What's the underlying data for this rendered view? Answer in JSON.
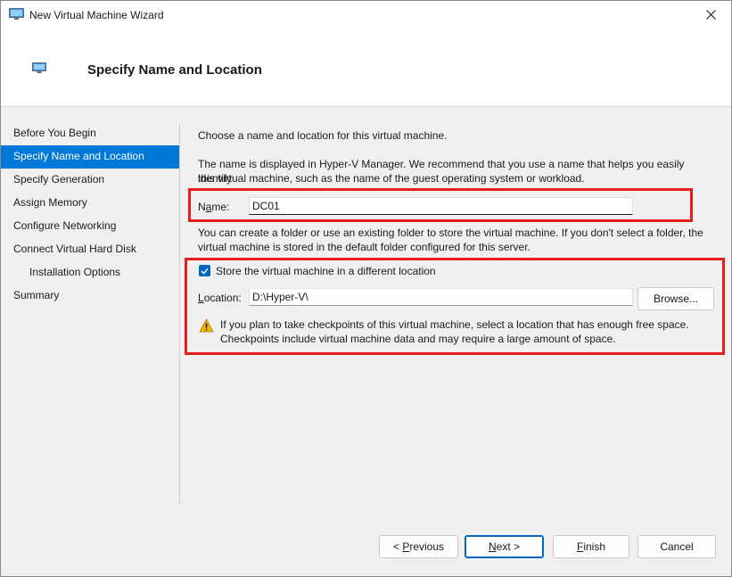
{
  "window": {
    "title": "New Virtual Machine Wizard"
  },
  "header": {
    "title": "Specify Name and Location"
  },
  "nav": {
    "items": [
      {
        "label": "Before You Begin"
      },
      {
        "label": "Specify Name and Location"
      },
      {
        "label": "Specify Generation"
      },
      {
        "label": "Assign Memory"
      },
      {
        "label": "Configure Networking"
      },
      {
        "label": "Connect Virtual Hard Disk"
      },
      {
        "label": "Installation Options"
      },
      {
        "label": "Summary"
      }
    ],
    "selected": "Specify Name and Location"
  },
  "content": {
    "intro": "Choose a name and location for this virtual machine.",
    "name_help_line1": "The name is displayed in Hyper-V Manager. We recommend that you use a name that helps you easily identify",
    "name_help_line2": "this virtual machine, such as the name of the guest operating system or workload.",
    "name_label_mnemonic": "a",
    "name_label_pre": "N",
    "name_label_post": "me:",
    "name_value": "DC01",
    "folder_help_line1": "You can create a folder or use an existing folder to store the virtual machine. If you don't select a folder, the",
    "folder_help_line2": "virtual machine is stored in the default folder configured for this server.",
    "store_checkbox_label": "Store the virtual machine in a different location",
    "store_checked": true,
    "location_label_mnemonic": "L",
    "location_label_post": "ocation:",
    "location_value": "D:\\Hyper-V\\",
    "browse_label": "Browse...",
    "warning_line1": "If you plan to take checkpoints of this virtual machine, select a location that has enough free space.",
    "warning_line2": "Checkpoints include virtual machine data and may require a large amount of space."
  },
  "buttons": {
    "previous_pre": "< ",
    "previous_mnemonic": "P",
    "previous_post": "revious",
    "next_mnemonic": "N",
    "next_post": "ext >",
    "finish_mnemonic": "F",
    "finish_post": "inish",
    "cancel": "Cancel"
  },
  "colors": {
    "accent": "#0078d7",
    "highlight_box": "#e81c1c",
    "warning": "#f2b705"
  },
  "icons": {
    "title": "vm-monitor-icon",
    "header": "vm-monitor-icon",
    "close": "close-icon",
    "warning": "warning-icon",
    "check": "checkmark-icon"
  }
}
